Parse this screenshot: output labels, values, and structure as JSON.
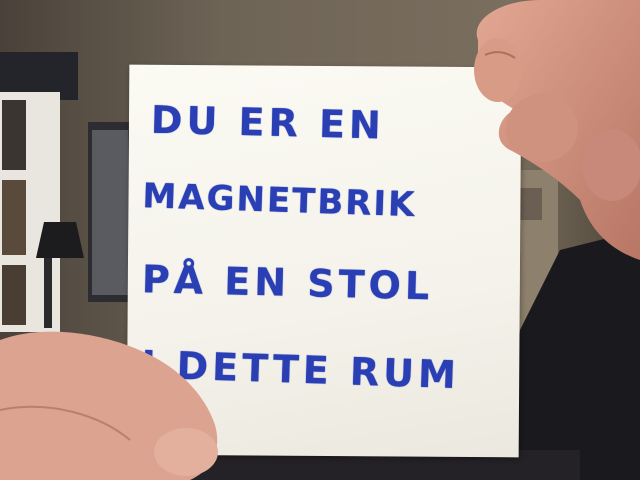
{
  "note": {
    "lines": [
      "DU ER EN",
      "MAGNETBRIK",
      "PÅ EN STOL",
      "I DETTE RUM"
    ]
  },
  "colors": {
    "ink": "#2a3fb4",
    "paper": "#f7f6ef",
    "wall": "#5f5549",
    "skin": "#d9a08e"
  }
}
